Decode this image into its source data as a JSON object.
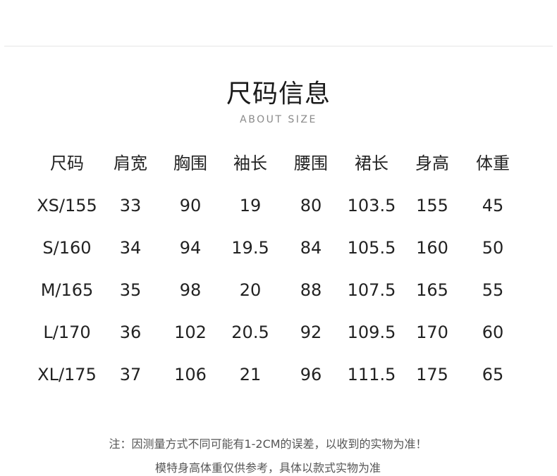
{
  "section": {
    "title": "尺码信息",
    "subtitle": "ABOUT SIZE"
  },
  "table": {
    "headers": [
      "尺码",
      "肩宽",
      "胸围",
      "袖长",
      "腰围",
      "裙长",
      "身高",
      "体重"
    ],
    "rows": [
      [
        "XS/155",
        "33",
        "90",
        "19",
        "80",
        "103.5",
        "155",
        "45"
      ],
      [
        "S/160",
        "34",
        "94",
        "19.5",
        "84",
        "105.5",
        "160",
        "50"
      ],
      [
        "M/165",
        "35",
        "98",
        "20",
        "88",
        "107.5",
        "165",
        "55"
      ],
      [
        "L/170",
        "36",
        "102",
        "20.5",
        "92",
        "109.5",
        "170",
        "60"
      ],
      [
        "XL/175",
        "37",
        "106",
        "21",
        "96",
        "111.5",
        "175",
        "65"
      ]
    ]
  },
  "notes": {
    "line1": "注：因测量方式不同可能有1-2CM的误差，以收到的实物为准！",
    "line2": "模特身高体重仅供参考，具体以款式实物为准"
  }
}
